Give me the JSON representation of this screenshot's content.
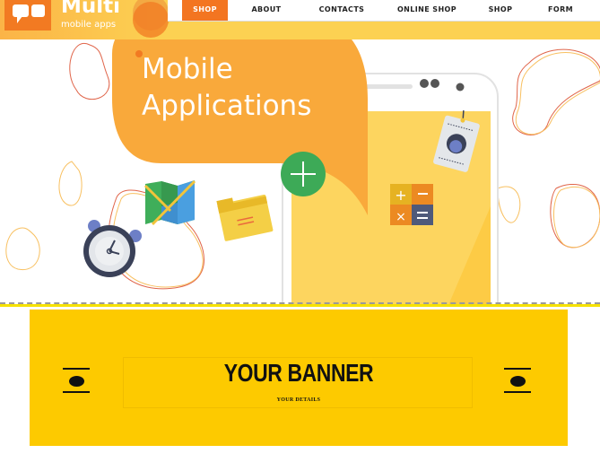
{
  "brand": {
    "name": "Multi",
    "tagline": "mobile apps"
  },
  "nav": {
    "items": [
      {
        "label": "SHOP",
        "active": true
      },
      {
        "label": "ABOUT",
        "active": false
      },
      {
        "label": "CONTACTS",
        "active": false
      },
      {
        "label": "ONLINE SHOP",
        "active": false
      },
      {
        "label": "SHOP",
        "active": false
      },
      {
        "label": "FORM",
        "active": false
      }
    ]
  },
  "hero": {
    "title_line1": "Mobile",
    "title_line2": "Applications",
    "icons": [
      "plus-icon",
      "map-icon",
      "folder-icon",
      "alarm-clock-icon",
      "calculator-icon",
      "id-badge-icon",
      "smartphone-icon"
    ]
  },
  "banner": {
    "title": "YOUR BANNER",
    "details": "YOUR DETAILS",
    "prev_icon": "prev-arrow-icon",
    "next_icon": "next-arrow-icon"
  },
  "colors": {
    "accent_orange": "#f37521",
    "bubble_orange": "#f9a93b",
    "topbar_yellow": "#fcd152",
    "banner_yellow": "#fdca00",
    "plus_green": "#3daa57"
  }
}
